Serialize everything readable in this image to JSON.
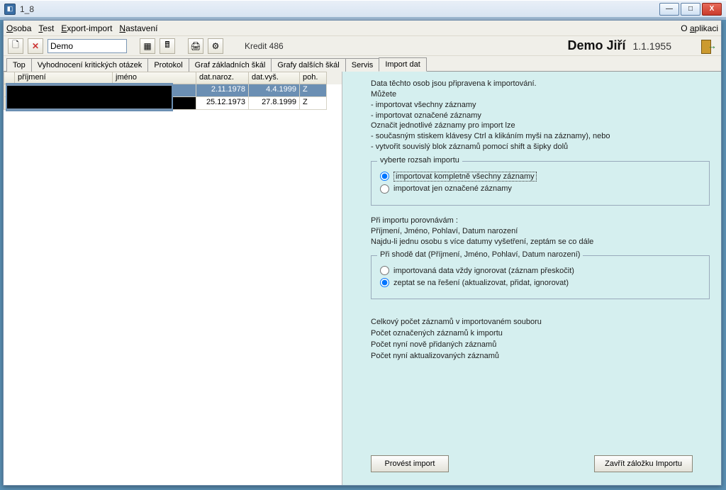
{
  "outer": {
    "title": "1_8"
  },
  "menu": {
    "osoba": "Osoba",
    "test": "Test",
    "exportimport": "Export-import",
    "nastaveni": "Nastavení",
    "oaplikaci": "O aplikaci"
  },
  "toolbar": {
    "combo": "Demo",
    "kredit": "Kredit 486"
  },
  "person": {
    "name": "Demo Jiří",
    "date": "1.1.1955"
  },
  "tabs": {
    "top": "Top",
    "vyhodnoceni": "Vyhodnocení kritických otázek",
    "protokol": "Protokol",
    "grafzakl": "Graf základních škál",
    "grafdalsich": "Grafy dalších škál",
    "servis": "Servis",
    "importdat": "Import dat"
  },
  "grid": {
    "headers": {
      "prijmeni": "příjmení",
      "jmeno": "jméno",
      "datnaroz": "dat.naroz.",
      "datvys": "dat.vyš.",
      "poh": "poh."
    },
    "rows": [
      {
        "datnaroz": "2.11.1978",
        "datvys": "4.4.1999",
        "poh": "Z"
      },
      {
        "datnaroz": "25.12.1973",
        "datvys": "27.8.1999",
        "poh": "Z"
      }
    ]
  },
  "right": {
    "intro": {
      "l1": "Data těchto osob jsou připravena k importování.",
      "l2": "Můžete",
      "l3": "- importovat všechny záznamy",
      "l4": "- importovat označené záznamy",
      "l5": "Označit jednotlivé záznamy pro import lze",
      "l6": "- současným stiskem klávesy Ctrl a klikáním myši na záznamy), nebo",
      "l7": "- vytvořit souvislý blok záznamů pomocí shift a šipky dolů"
    },
    "scope": {
      "legend": "vyberte rozsah importu",
      "optAll": "importovat kompletně všechny záznamy",
      "optMarked": "importovat jen označené záznamy"
    },
    "compare": {
      "l1": "Při importu porovnávám :",
      "l2": "Příjmení, Jméno, Pohlaví, Datum narození",
      "l3": "Najdu-li jednu osobu s více datumy vyšetření, zeptám se co dále"
    },
    "conflict": {
      "legend": "Při shodě dat (Příjmení, Jméno, Pohlaví, Datum narození)",
      "optIgnore": "importovaná data vždy ignorovat (záznam přeskočit)",
      "optAsk": "zeptat se na řešení (aktualizovat, přidat, ignorovat)"
    },
    "stats": {
      "s1": "Celkový počet záznamů v importovaném souboru",
      "s2": "Počet označených záznamů k importu",
      "s3": "Počet nyní nově přidaných záznamů",
      "s4": "Počet nyní aktualizovaných záznamů"
    },
    "btnImport": "Provést import",
    "btnClose": "Zavřít záložku Importu"
  }
}
